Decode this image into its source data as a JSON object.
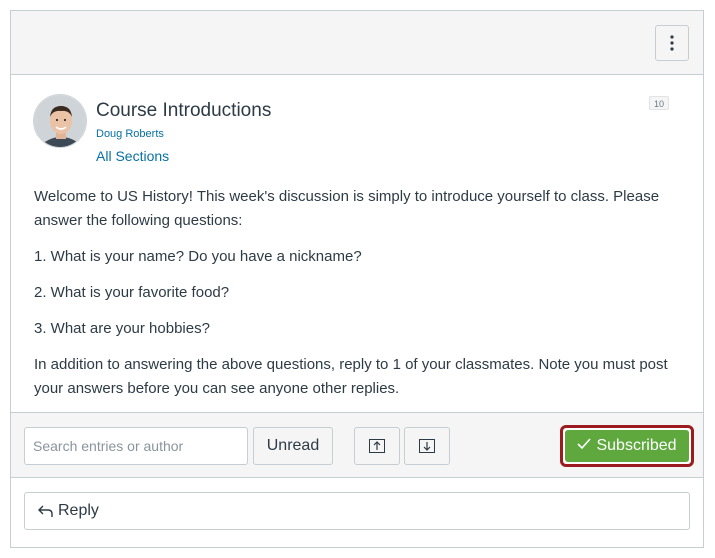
{
  "topic": {
    "title": "Course Introductions",
    "author": "Doug Roberts",
    "sections": "All Sections",
    "unread_count": "10",
    "body": [
      "Welcome to US History! This week's discussion is simply to introduce yourself to class. Please answer the following questions:",
      "1. What is your name? Do you have a nickname?",
      "2. What is your favorite food?",
      "3. What are your hobbies?",
      "In addition to answering the above questions, reply to 1 of your classmates. Note you must post your answers before you can see anyone other replies."
    ]
  },
  "toolbar": {
    "search_placeholder": "Search entries or author",
    "unread_label": "Unread",
    "subscribed_label": "Subscribed"
  },
  "reply": {
    "label": "Reply"
  },
  "icons": {
    "kebab": "vertical-dots-icon",
    "collapse": "collapse-all-icon",
    "expand": "expand-all-icon",
    "check": "checkmark-icon",
    "reply": "reply-arrow-icon"
  },
  "colors": {
    "link": "#0770a3",
    "subscribed_bg": "#5ea83e",
    "highlight_border": "#9c1b1f"
  }
}
